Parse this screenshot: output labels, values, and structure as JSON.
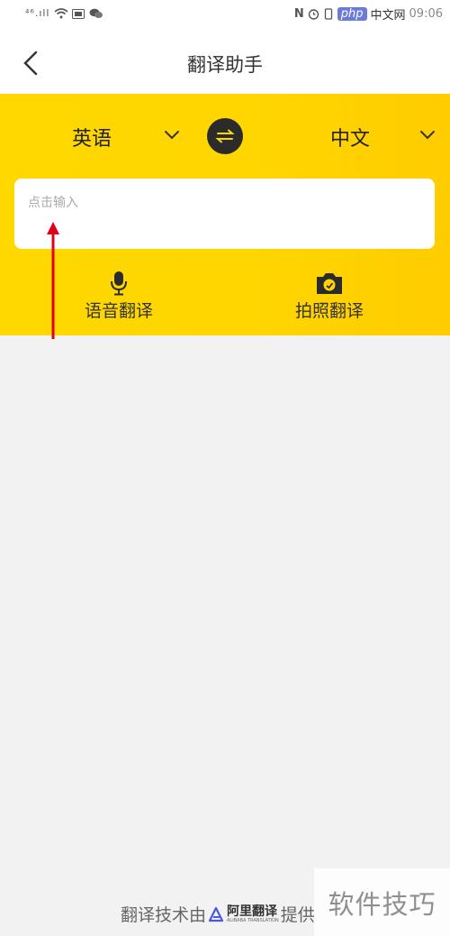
{
  "status_bar": {
    "signal_text": "⁴⁶.ıll",
    "badge": "php",
    "badge_site": "中文网",
    "time": "09:06"
  },
  "nav": {
    "title": "翻译助手"
  },
  "translator": {
    "source_language": "英语",
    "target_language": "中文",
    "input_placeholder": "点击输入",
    "input_value": ""
  },
  "actions": {
    "voice_label": "语音翻译",
    "photo_label": "拍照翻译"
  },
  "footer": {
    "prefix": "翻译技术由",
    "brand": "阿里翻译",
    "brand_sub": "ALIBABA TRANSLATION",
    "suffix": "提供"
  },
  "watermark": {
    "text": "软件技巧"
  },
  "colors": {
    "accent_yellow": "#ffd600",
    "swap_dark": "#2b2b2b",
    "annotation_red": "#e0001b"
  }
}
